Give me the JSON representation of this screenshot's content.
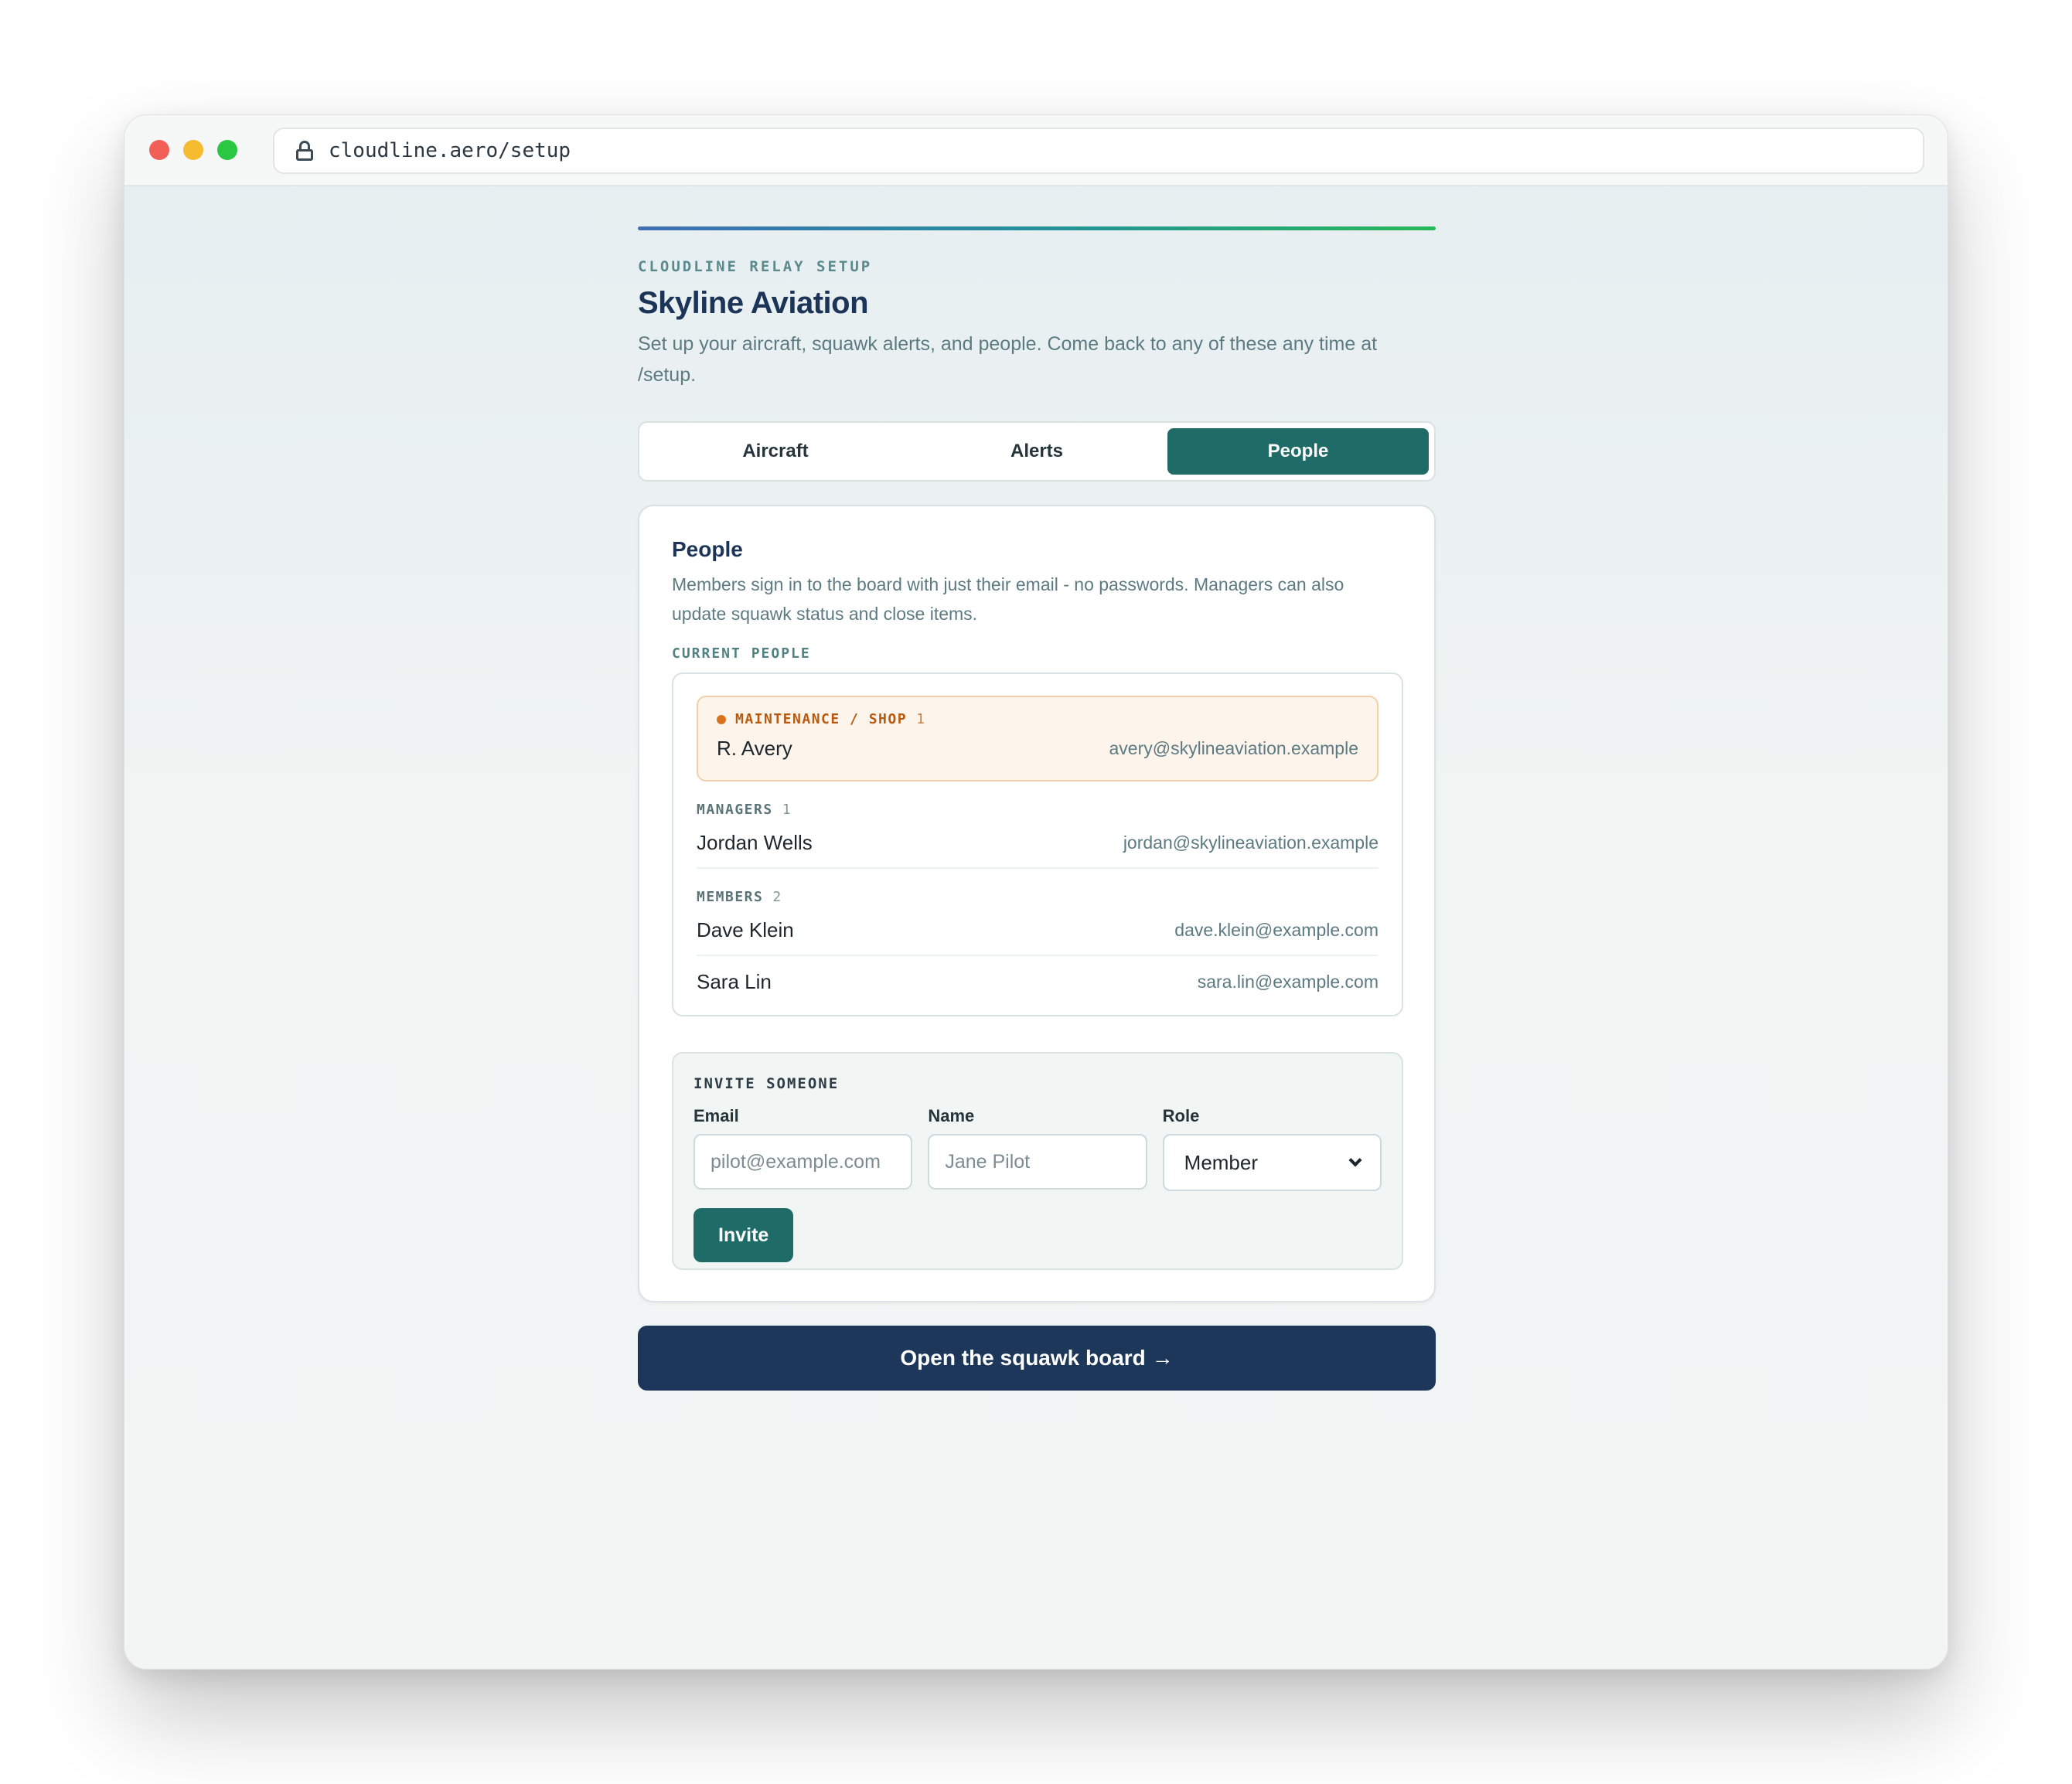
{
  "browser": {
    "url": "cloudline.aero/setup"
  },
  "header": {
    "eyebrow": "CLOUDLINE RELAY SETUP",
    "title": "Skyline Aviation",
    "subtitle": "Set up your aircraft, squawk alerts, and people. Come back to any of these any time at /setup."
  },
  "tabs": [
    {
      "label": "Aircraft",
      "active": false
    },
    {
      "label": "Alerts",
      "active": false
    },
    {
      "label": "People",
      "active": true
    }
  ],
  "people_card": {
    "title": "People",
    "description": "Members sign in to the board with just their email - no passwords. Managers can also update squawk status and close items.",
    "current_label": "CURRENT PEOPLE",
    "maintenance": {
      "label": "MAINTENANCE / SHOP",
      "count": "1",
      "people": [
        {
          "name": "R. Avery",
          "email": "avery@skylineaviation.example"
        }
      ]
    },
    "managers": {
      "label": "MANAGERS",
      "count": "1",
      "people": [
        {
          "name": "Jordan Wells",
          "email": "jordan@skylineaviation.example"
        }
      ]
    },
    "members": {
      "label": "MEMBERS",
      "count": "2",
      "people": [
        {
          "name": "Dave Klein",
          "email": "dave.klein@example.com"
        },
        {
          "name": "Sara Lin",
          "email": "sara.lin@example.com"
        }
      ]
    },
    "invite": {
      "title": "INVITE SOMEONE",
      "email_label": "Email",
      "email_placeholder": "pilot@example.com",
      "name_label": "Name",
      "name_placeholder": "Jane Pilot",
      "role_label": "Role",
      "role_value": "Member",
      "button_label": "Invite"
    }
  },
  "footer": {
    "board_button": "Open the squawk board →"
  },
  "colors": {
    "accent": "#1f6b67",
    "navy": "#1c3759",
    "maintenance": "#b8590e"
  }
}
